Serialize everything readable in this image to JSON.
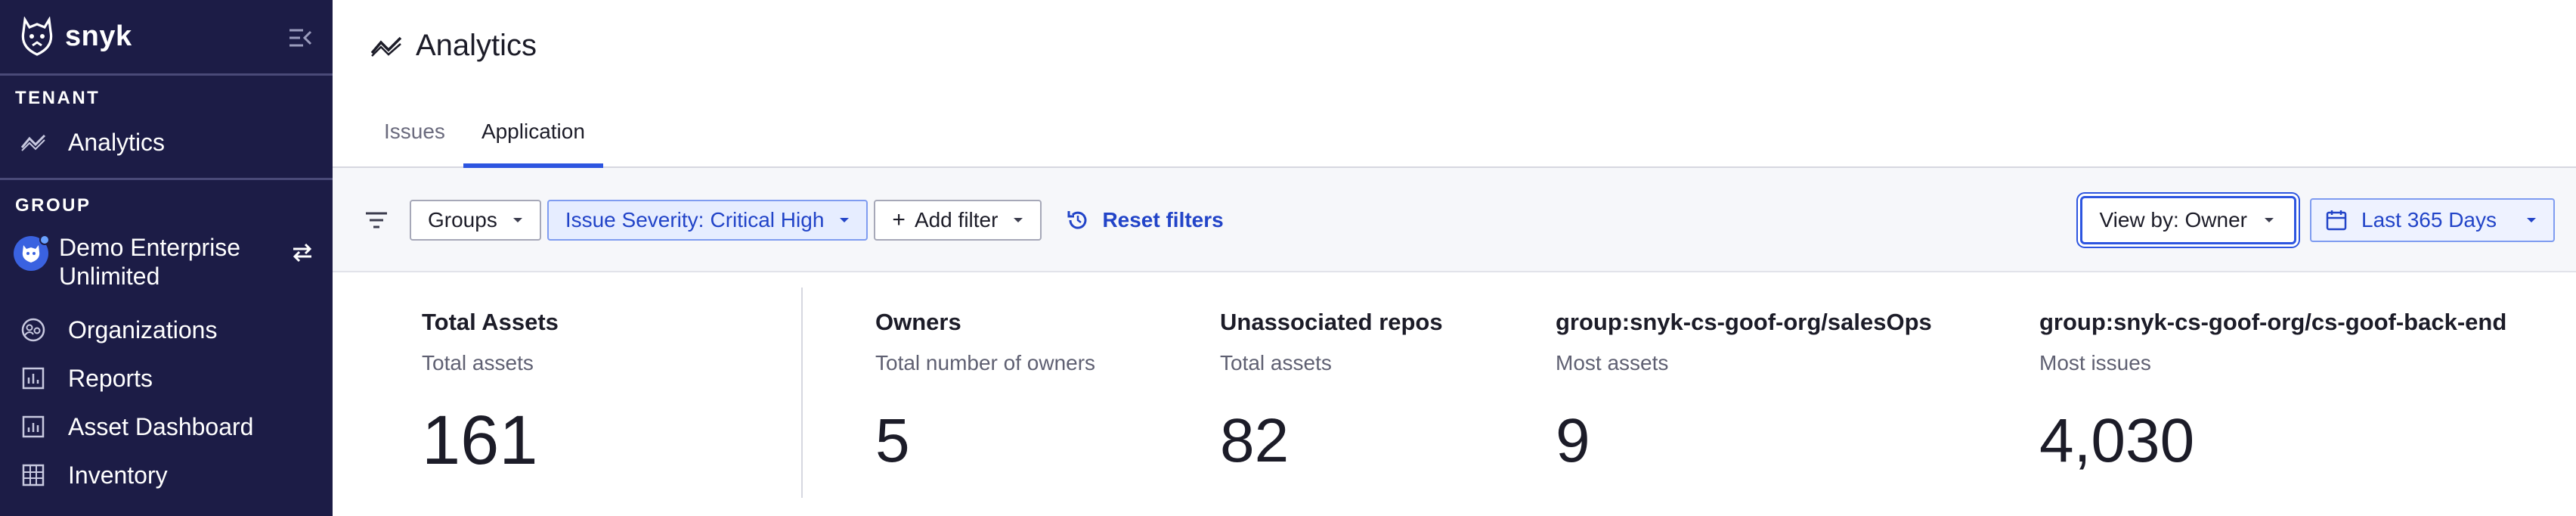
{
  "sidebar": {
    "logo_text": "snyk",
    "tenant_label": "TENANT",
    "tenant_items": [
      {
        "label": "Analytics",
        "icon": "analytics-trend-icon"
      }
    ],
    "group_label": "GROUP",
    "org_name": "Demo Enterprise Unlimited",
    "group_items": [
      {
        "label": "Organizations",
        "icon": "organizations-icon"
      },
      {
        "label": "Reports",
        "icon": "reports-icon"
      },
      {
        "label": "Asset Dashboard",
        "icon": "asset-dashboard-icon"
      },
      {
        "label": "Inventory",
        "icon": "inventory-grid-icon"
      }
    ]
  },
  "header": {
    "title": "Analytics",
    "tabs": [
      {
        "label": "Issues",
        "active": false
      },
      {
        "label": "Application",
        "active": true
      }
    ]
  },
  "filters": {
    "groups_label": "Groups",
    "severity_prefix": "Issue Severity:",
    "severity_value": "Critical High",
    "add_filter_label": "Add filter",
    "reset_label": "Reset filters",
    "view_by_label": "View by: Owner",
    "date_range_label": "Last 365 Days"
  },
  "metrics": [
    {
      "title": "Total Assets",
      "subtitle": "Total assets",
      "value": "161"
    },
    {
      "title": "Owners",
      "subtitle": "Total number of owners",
      "value": "5"
    },
    {
      "title": "Unassociated repos",
      "subtitle": "Total assets",
      "value": "82"
    },
    {
      "title": "group:snyk-cs-goof-org/salesOps",
      "subtitle": "Most assets",
      "value": "9"
    },
    {
      "title": "group:snyk-cs-goof-org/cs-goof-back-end",
      "subtitle": "Most issues",
      "value": "4,030"
    }
  ],
  "colors": {
    "sidebar_bg": "#1c1c46",
    "accent": "#2d55e0",
    "chip_blue_bg": "#e6edff",
    "link_blue": "#2244c8"
  }
}
